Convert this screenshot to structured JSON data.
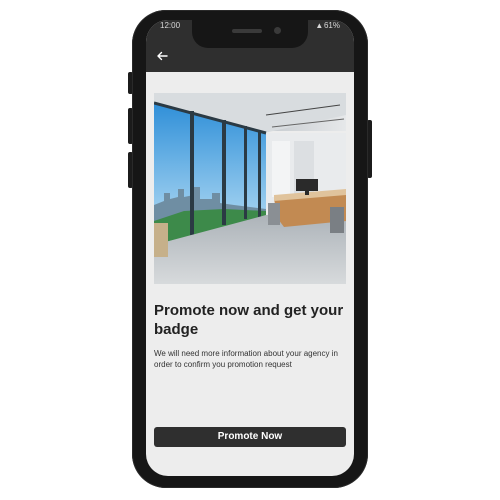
{
  "status_bar": {
    "time": "12:00",
    "battery": "61%"
  },
  "app_bar": {
    "back_icon": "arrow-left-icon"
  },
  "hero_image": {
    "subject": "office-interior-photo"
  },
  "content": {
    "title": "Promote now and get your badge",
    "description": "We will need more information about your agency in order to confirm you promotion request"
  },
  "actions": {
    "promote_label": "Promote Now"
  },
  "colors": {
    "app_bar": "#2f2f2f",
    "screen_bg": "#ededed",
    "button_bg": "#2f2f2f",
    "button_text": "#ffffff",
    "title_text": "#222222"
  }
}
